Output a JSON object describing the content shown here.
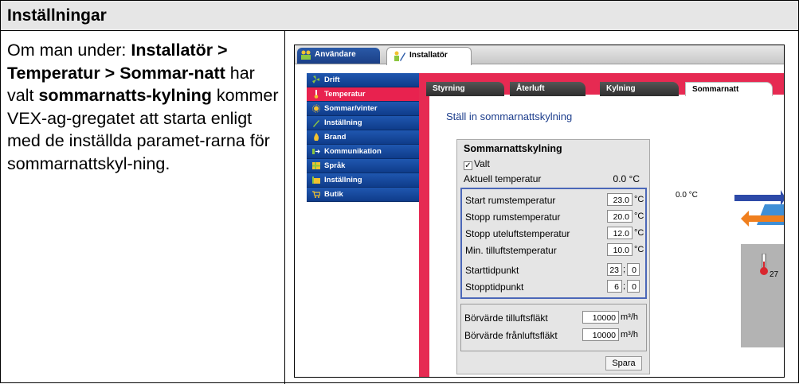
{
  "document": {
    "header": "Inställningar",
    "body_parts": [
      {
        "text": "Om man under: ",
        "bold": false
      },
      {
        "text": "Installatör > Temperatur > Sommar-natt",
        "bold": true
      },
      {
        "text": " har valt ",
        "bold": false
      },
      {
        "text": "sommarnatts-kylning",
        "bold": true
      },
      {
        "text": " kommer VEX-ag-gregatet att starta enligt med de inställda paramet-rarna för sommarnattskyl-ning.",
        "bold": false
      }
    ]
  },
  "app": {
    "top_tabs": [
      "Användare",
      "Installatör"
    ],
    "menu": [
      {
        "label": "Drift",
        "icon": "fan-icon",
        "active": false
      },
      {
        "label": "Temperatur",
        "icon": "thermometer-icon",
        "active": true
      },
      {
        "label": "Sommar/vinter",
        "icon": "sun-icon",
        "active": false
      },
      {
        "label": "Inställning",
        "icon": "wrench-icon",
        "active": false
      },
      {
        "label": "Brand",
        "icon": "fire-icon",
        "active": false
      },
      {
        "label": "Kommunikation",
        "icon": "communication-icon",
        "active": false
      },
      {
        "label": "Språk",
        "icon": "language-icon",
        "active": false
      },
      {
        "label": "Inställning",
        "icon": "settings-icon",
        "active": false
      },
      {
        "label": "Butik",
        "icon": "cart-icon",
        "active": false
      }
    ],
    "content_tabs": [
      "Styrning",
      "Återluft",
      "Kylning",
      "Sommarnatt"
    ],
    "selected_tab": "Sommarnatt",
    "section_title": "Ställ in sommarnattskylning",
    "panel": {
      "title": "Sommarnattskylning",
      "checkbox_label": "Valt",
      "checkbox_checked": true,
      "aktuell_label": "Aktuell temperatur",
      "aktuell_value": "0.0 °C",
      "fields": [
        {
          "label": "Start rumstemperatur",
          "value": "23.0",
          "unit": "°C"
        },
        {
          "label": "Stopp rumstemperatur",
          "value": "20.0",
          "unit": "°C"
        },
        {
          "label": "Stopp uteluftstemperatur",
          "value": "12.0",
          "unit": "°C"
        },
        {
          "label": "Min. tilluftstemperatur",
          "value": "10.0",
          "unit": "°C"
        }
      ],
      "time_fields": [
        {
          "label": "Starttidpunkt",
          "hour": "23",
          "minute": "0"
        },
        {
          "label": "Stopptidpunkt",
          "hour": "6",
          "minute": "0"
        }
      ],
      "fan_fields": [
        {
          "label": "Börvärde tilluftsfläkt",
          "value": "10000",
          "unit": "m³/h"
        },
        {
          "label": "Börvärde frånluftsfläkt",
          "value": "10000",
          "unit": "m³/h"
        }
      ],
      "save_label": "Spara"
    },
    "right_temp": "0.0 °C",
    "right_partial": "27"
  }
}
